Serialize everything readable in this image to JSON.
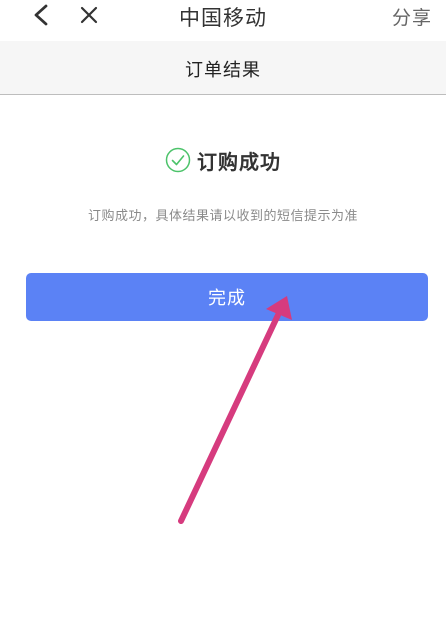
{
  "topbar": {
    "title": "中国移动",
    "share_label": "分享"
  },
  "header": {
    "title": "订单结果"
  },
  "result": {
    "title": "订购成功",
    "description": "订购成功，具体结果请以收到的短信提示为准"
  },
  "actions": {
    "done_label": "完成"
  },
  "colors": {
    "primary": "#5b82f5",
    "success": "#4cc36a",
    "annotation": "#d63b7e"
  }
}
